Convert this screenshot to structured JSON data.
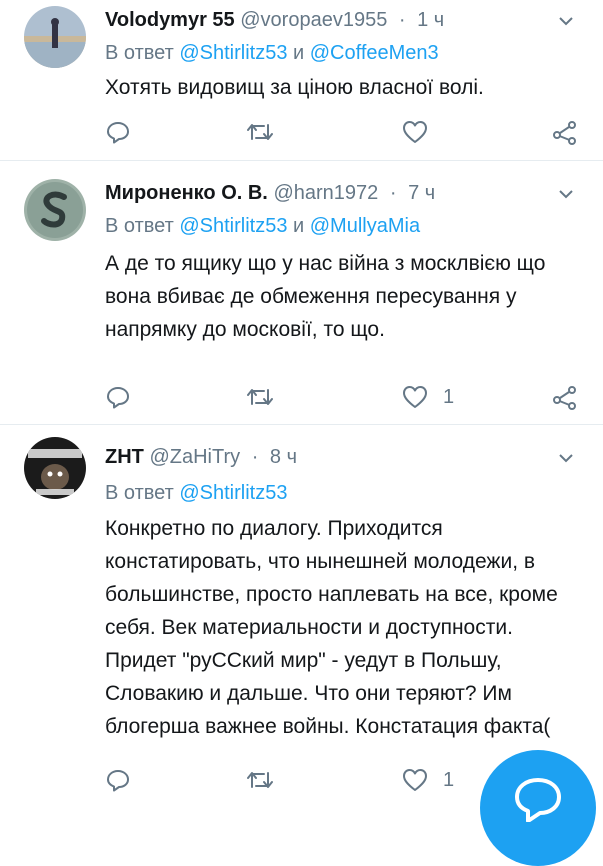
{
  "tweets": [
    {
      "name": "Volodymyr 55",
      "handle": "@voropaev1955",
      "time": "1 ч",
      "reply_prefix": "В ответ",
      "reply_mention_1": "@Shtirlitz53",
      "reply_joiner": "и",
      "reply_mention_2": "@CoffeeMen3",
      "text": "Хотять видовищ за ціною власної волі.",
      "like_count": ""
    },
    {
      "name": "Мироненко О. В.",
      "handle": "@harn1972",
      "time": "7 ч",
      "reply_prefix": "В ответ",
      "reply_mention_1": "@Shtirlitz53",
      "reply_joiner": "и",
      "reply_mention_2": "@MullyaMia",
      "text": "А де то ящику що у нас війна з москлвією що вона вбиває де обмеження пересування у напрямку до московії, то що.",
      "like_count": "1"
    },
    {
      "name": "ZHT",
      "handle": "@ZaHiTry",
      "time": "8 ч",
      "reply_prefix": "В ответ",
      "reply_mention_1": "@Shtirlitz53",
      "text": "Конкретно по диалогу. Приходится констатировать, что нынешней молодежи, в большинстве, просто наплевать на все, кроме себя. Век материальности и доступности. Придет \"руССкий мир\" - уедут в Польшу, Словакию и дальше. Что они теряют? Им блогерша важнее войны. Констатация факта(",
      "like_count": "1"
    }
  ],
  "colors": {
    "accent": "#1da1f2",
    "secondary_text": "#657786",
    "divider": "#e6ecf0"
  },
  "icons": [
    "chevron-down-icon",
    "reply-icon",
    "retweet-icon",
    "like-icon",
    "share-icon",
    "compose-icon"
  ]
}
